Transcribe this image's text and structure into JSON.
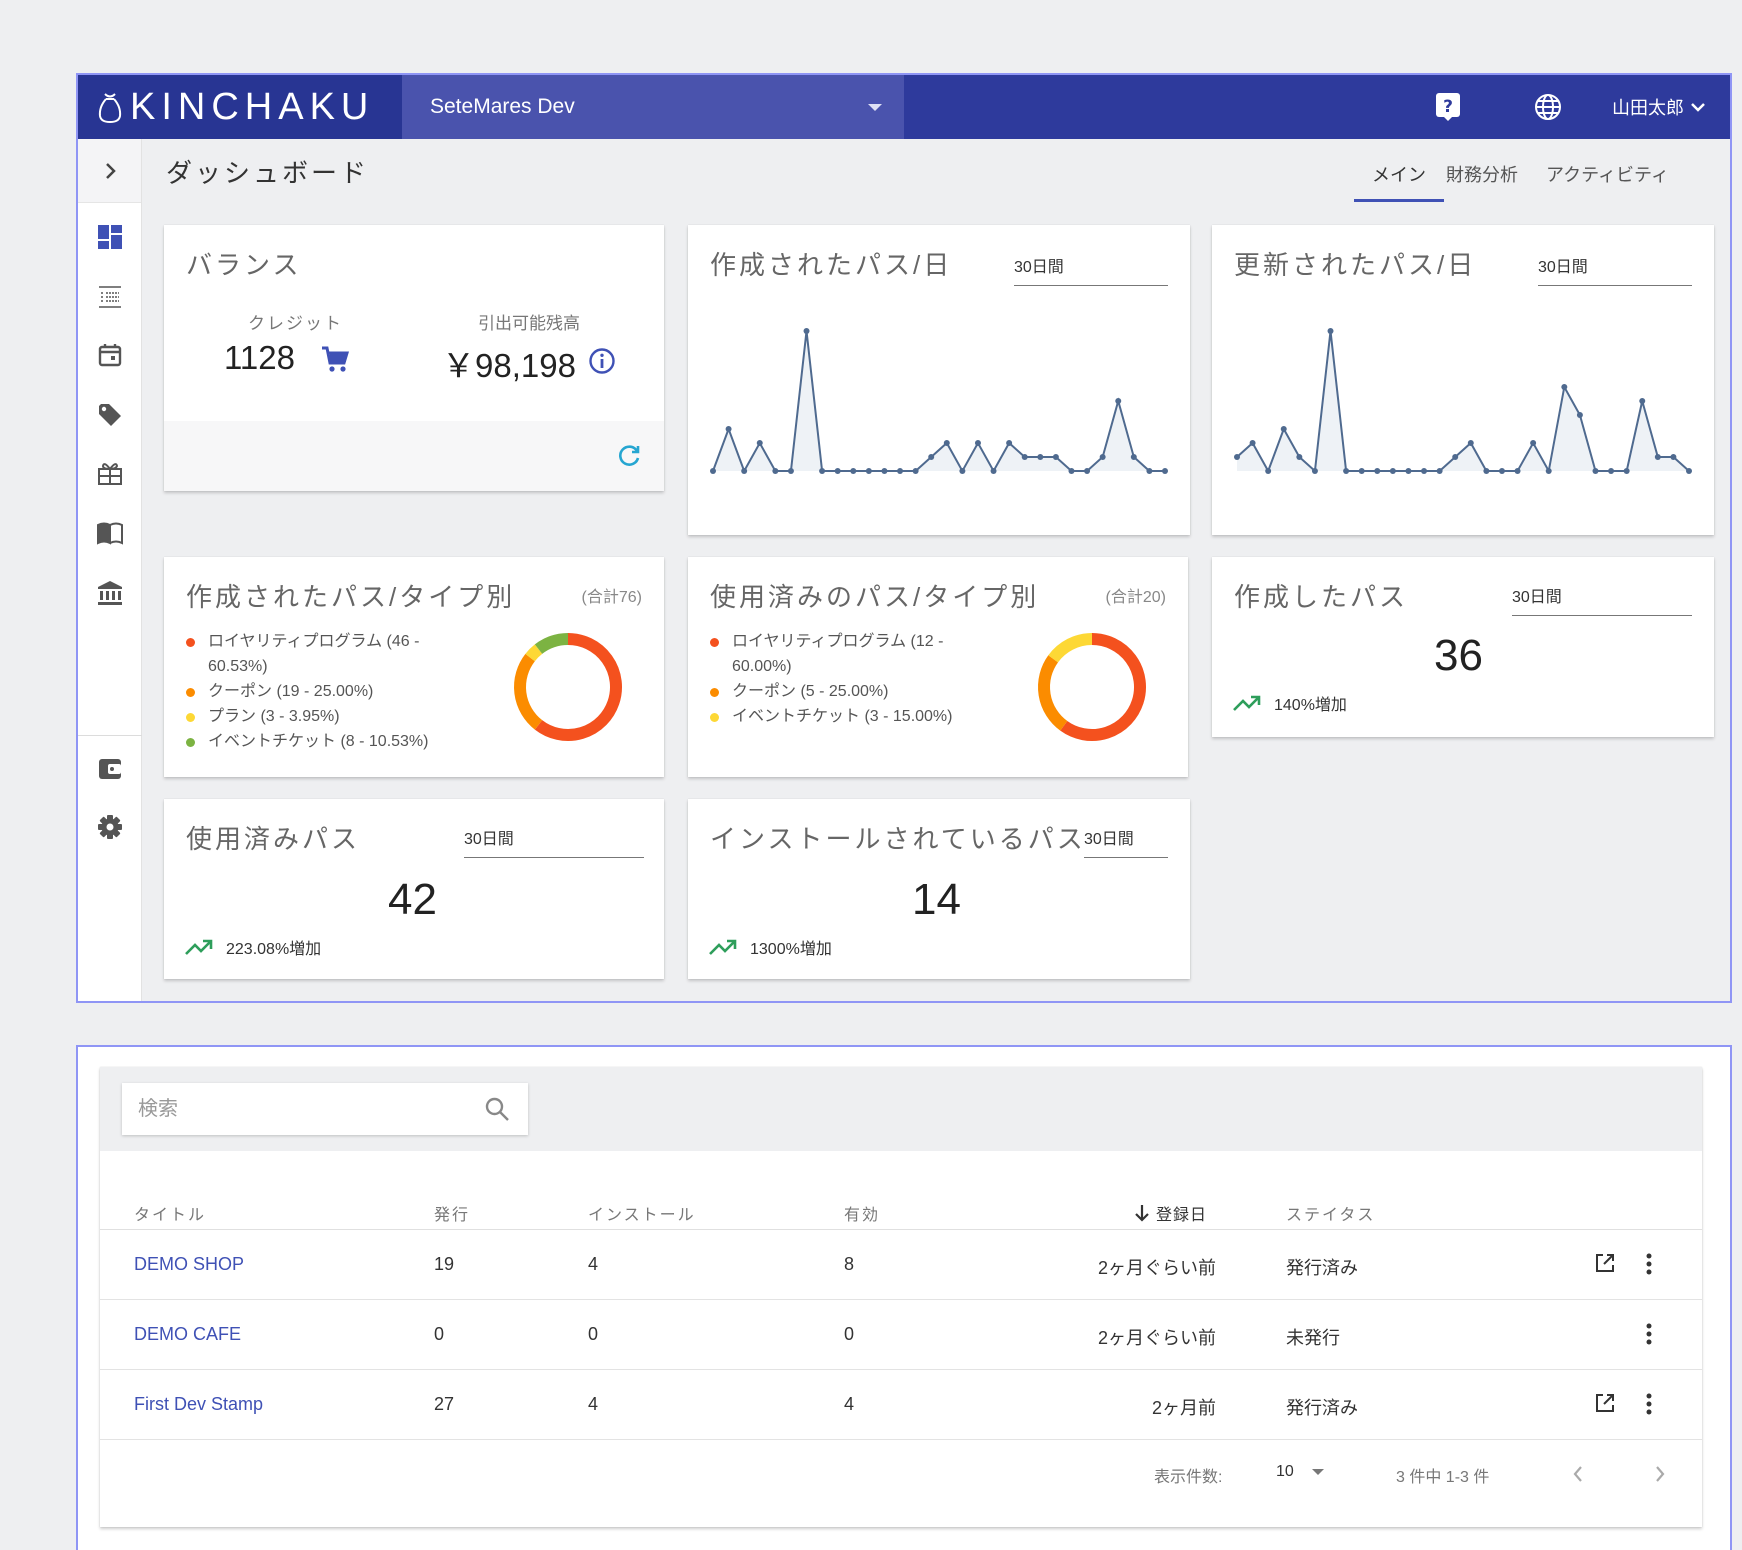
{
  "app": {
    "brand": "KINCHAKU",
    "project": "SeteMares Dev",
    "user": "山田太郎"
  },
  "page": {
    "title": "ダッシュボード",
    "tabs": [
      "メイン",
      "財務分析",
      "アクティビティ"
    ],
    "active_tab": "メイン"
  },
  "sidebar": {
    "icons": [
      "dashboard-icon",
      "list-icon",
      "calendar-icon",
      "tag-icon",
      "gift-icon",
      "book-icon",
      "bank-icon",
      "wallet-icon",
      "settings-icon"
    ]
  },
  "balance": {
    "title": "バランス",
    "credit_label": "クレジット",
    "credit_value": "1128",
    "withdraw_label": "引出可能残高",
    "withdraw_value": "￥98,198"
  },
  "created_per_day": {
    "title": "作成されたパス/日",
    "period": "30日間",
    "values": [
      0,
      3,
      0,
      2,
      0,
      0,
      10,
      0,
      0,
      0,
      0,
      0,
      0,
      0,
      1,
      2,
      0,
      2,
      0,
      2,
      1,
      1,
      1,
      0,
      0,
      1,
      5,
      1,
      0,
      0
    ]
  },
  "updated_per_day": {
    "title": "更新されたパス/日",
    "period": "30日間",
    "values": [
      1,
      2,
      0,
      3,
      1,
      0,
      10,
      0,
      0,
      0,
      0,
      0,
      0,
      0,
      1,
      2,
      0,
      0,
      0,
      2,
      0,
      6,
      4,
      0,
      0,
      0,
      5,
      1,
      1,
      0
    ]
  },
  "created_by_type": {
    "title": "作成されたパス/タイプ別",
    "total": "(合計76)",
    "legend": [
      {
        "label": "ロイヤリティプログラム (46 - 60.53%)",
        "color": "#f4511e",
        "value": 46
      },
      {
        "label": "クーポン (19 - 25.00%)",
        "color": "#fb8c00",
        "value": 19
      },
      {
        "label": "プラン (3 - 3.95%)",
        "color": "#fdd835",
        "value": 3
      },
      {
        "label": "イベントチケット (8 - 10.53%)",
        "color": "#7cb342",
        "value": 8
      }
    ]
  },
  "used_by_type": {
    "title": "使用済みのパス/タイプ別",
    "total": "(合計20)",
    "legend": [
      {
        "label": "ロイヤリティプログラム (12 - 60.00%)",
        "color": "#f4511e",
        "value": 12
      },
      {
        "label": "クーポン (5 - 25.00%)",
        "color": "#fb8c00",
        "value": 5
      },
      {
        "label": "イベントチケット (3 - 15.00%)",
        "color": "#fdd835",
        "value": 3
      }
    ]
  },
  "created_passes": {
    "title": "作成したパス",
    "period": "30日間",
    "value": "36",
    "trend": "140%増加"
  },
  "used_passes": {
    "title": "使用済みパス",
    "period": "30日間",
    "value": "42",
    "trend": "223.08%増加"
  },
  "installed_passes": {
    "title": "インストールされているパス",
    "period": "30日間",
    "value": "14",
    "trend": "1300%増加"
  },
  "table": {
    "search_placeholder": "検索",
    "columns": [
      "タイトル",
      "発行",
      "インストール",
      "有効",
      "登録日",
      "ステイタス"
    ],
    "rows": [
      {
        "title": "DEMO SHOP",
        "issued": "19",
        "installed": "4",
        "active": "8",
        "date": "2ヶ月ぐらい前",
        "status": "発行済み",
        "external": true
      },
      {
        "title": "DEMO CAFE",
        "issued": "0",
        "installed": "0",
        "active": "0",
        "date": "2ヶ月ぐらい前",
        "status": "未発行",
        "external": false
      },
      {
        "title": "First Dev Stamp",
        "issued": "27",
        "installed": "4",
        "active": "4",
        "date": "2ヶ月前",
        "status": "発行済み",
        "external": true
      }
    ],
    "rows_per_page_label": "表示件数:",
    "rows_per_page": "10",
    "range": "3 件中 1-3 件"
  },
  "colors": {
    "header": "#2e3a9c",
    "logo_bg": "#283593",
    "project_bg": "#4a53ad",
    "accent": "#3f51b5",
    "chart_line": "#4f6a8f",
    "trend_up": "#2e9e5b"
  }
}
